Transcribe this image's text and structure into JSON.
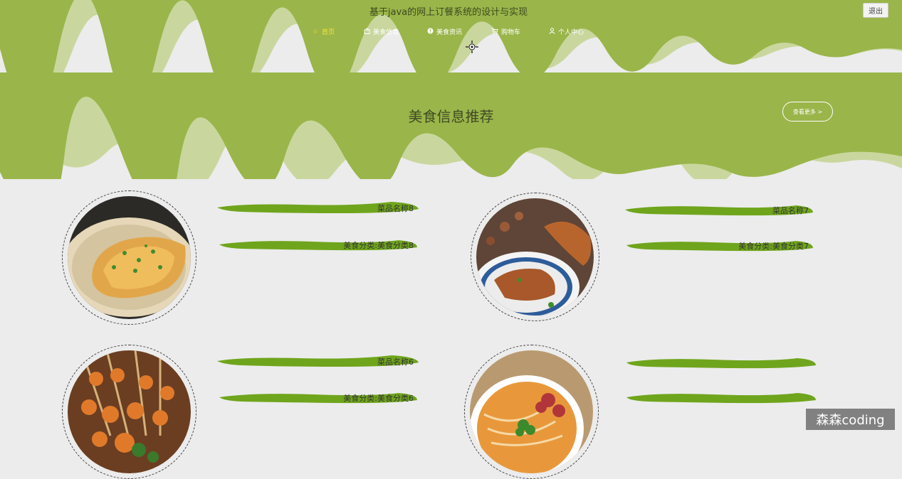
{
  "header": {
    "site_title": "基于java的网上订餐系统的设计与实现",
    "logout_label": "退出"
  },
  "nav": {
    "items": [
      {
        "label": "首页",
        "icon": "star-icon",
        "active": true
      },
      {
        "label": "美食信息",
        "icon": "bag-icon",
        "active": false
      },
      {
        "label": "美食资讯",
        "icon": "info-icon",
        "active": false
      },
      {
        "label": "购物车",
        "icon": "cart-icon",
        "active": false
      },
      {
        "label": "个人中心",
        "icon": "user-icon",
        "active": false
      }
    ]
  },
  "section": {
    "title": "美食信息推荐",
    "more_label": "查看更多 >"
  },
  "cards": [
    {
      "name": "菜品名称8",
      "category": "美食分类:美食分类8"
    },
    {
      "name": "菜品名称7",
      "category": "美食分类:美食分类7"
    },
    {
      "name": "菜品名称6",
      "category": "美食分类:美食分类6"
    },
    {
      "name": "",
      "category": ""
    }
  ],
  "watermark": "森森coding",
  "colors": {
    "header_green": "#9ab54a",
    "brush_green": "#6fa51c",
    "background": "#ececec",
    "nav_active": "#f5e23a"
  }
}
